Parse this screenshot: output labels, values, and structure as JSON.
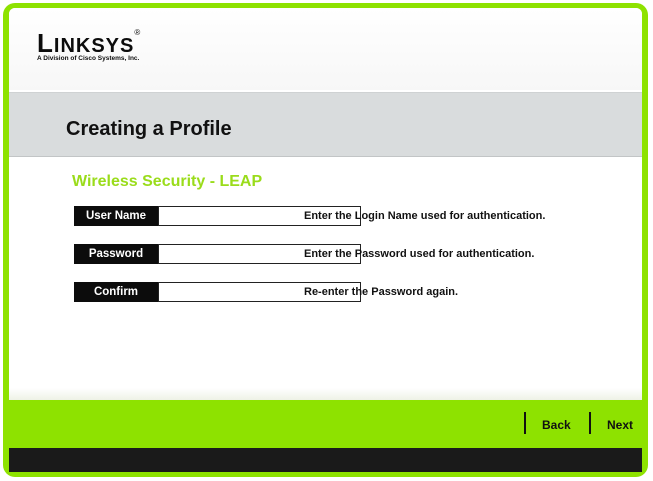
{
  "brand": {
    "name": "Linksys",
    "tagline": "A Division of Cisco Systems, Inc."
  },
  "header": {
    "title": "Creating a Profile"
  },
  "section": {
    "title": "Wireless Security - LEAP"
  },
  "fields": [
    {
      "label": "User Name",
      "value": "",
      "help": "Enter the Login Name used for authentication."
    },
    {
      "label": "Password",
      "value": "",
      "help": "Enter the Password used for authentication."
    },
    {
      "label": "Confirm",
      "value": "",
      "help": "Re-enter the Password again."
    }
  ],
  "footer": {
    "back_label": "Back",
    "next_label": "Next"
  },
  "colors": {
    "accent": "#8ee200",
    "section_title": "#9adc1b",
    "label_bg": "#0c0c0c",
    "band": "#d9dcdd"
  }
}
